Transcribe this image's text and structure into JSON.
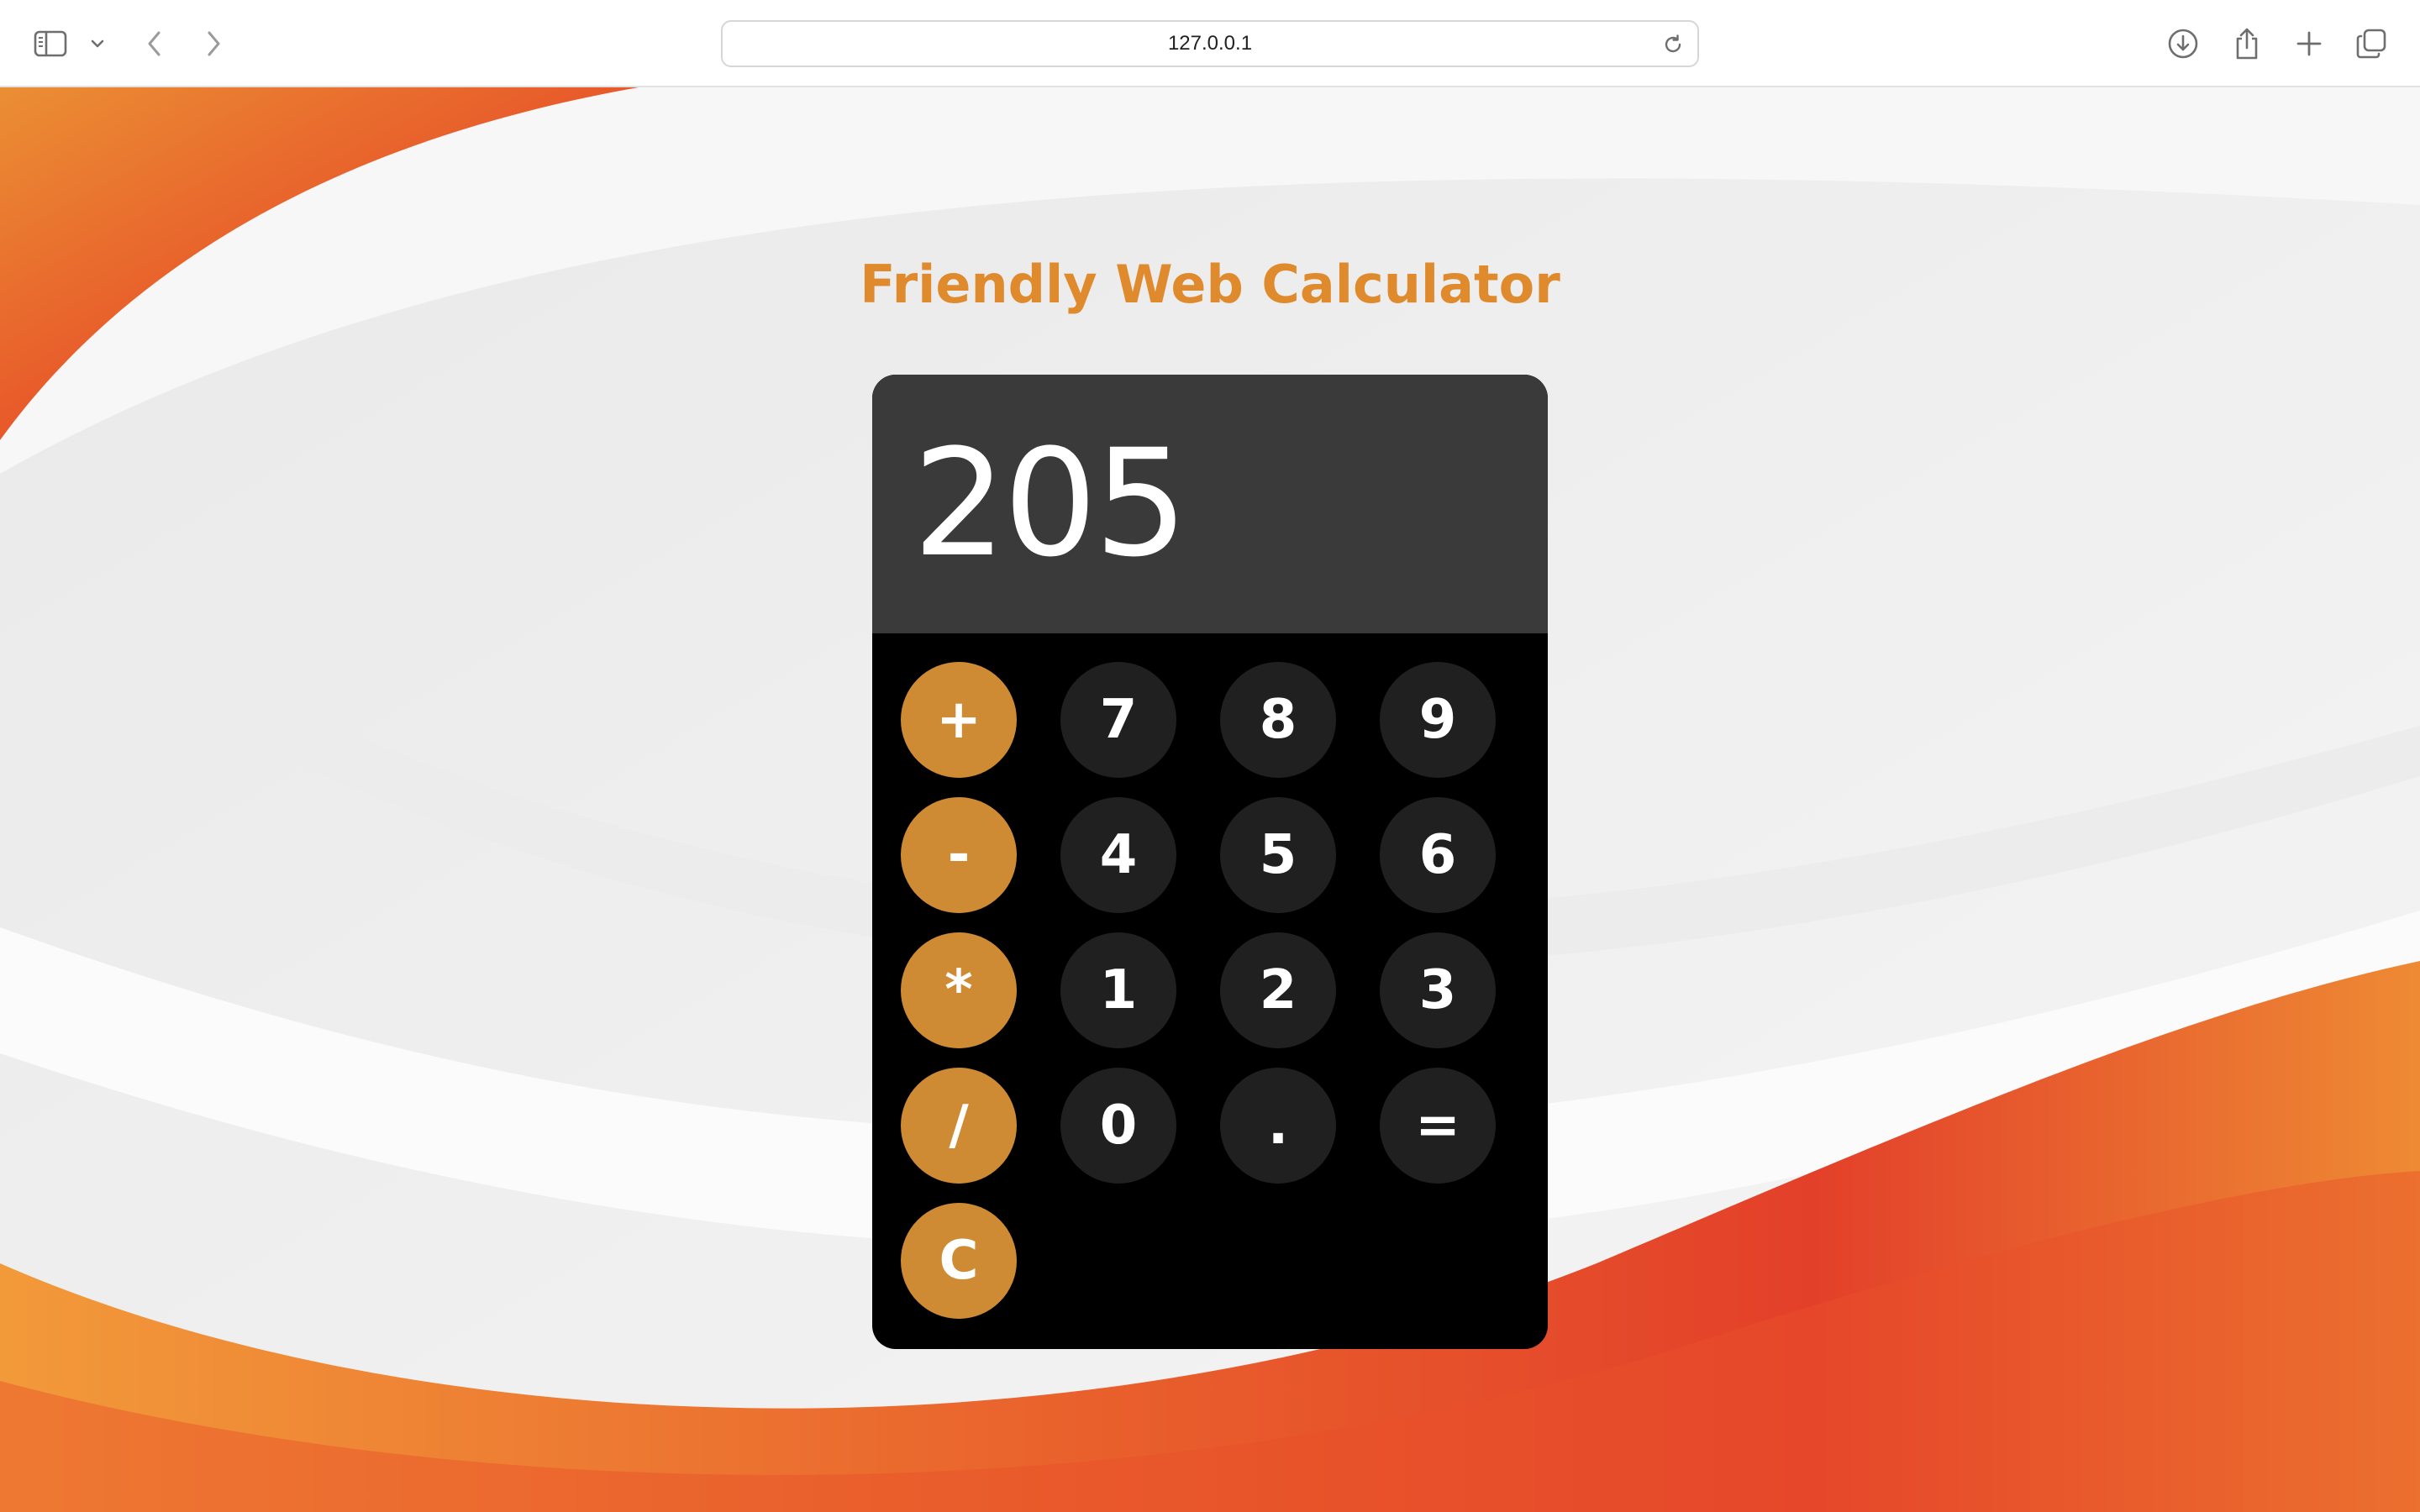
{
  "browser": {
    "address": "127.0.0.1",
    "icons": {
      "sidebar": "sidebar-icon",
      "sidebar_menu": "chevron-down-icon",
      "back": "chevron-left-icon",
      "forward": "chevron-right-icon",
      "reload": "reload-icon",
      "download": "download-icon",
      "share": "share-icon",
      "new_tab": "plus-icon",
      "tabs": "tab-overview-icon"
    }
  },
  "page": {
    "title": "Friendly Web Calculator"
  },
  "calculator": {
    "display": "205",
    "keys": {
      "add": "+",
      "subtract": "-",
      "multiply": "*",
      "divide": "/",
      "clear": "C",
      "seven": "7",
      "eight": "8",
      "nine": "9",
      "four": "4",
      "five": "5",
      "six": "6",
      "one": "1",
      "two": "2",
      "three": "3",
      "zero": "0",
      "decimal": ".",
      "equals": "="
    }
  },
  "colors": {
    "title": "#e08a2e",
    "operator_key": "#cf8b34",
    "number_key": "#202020",
    "display_bg": "#3a3a3a",
    "calculator_bg": "#000000",
    "wallpaper_orange": "#e8582a"
  }
}
